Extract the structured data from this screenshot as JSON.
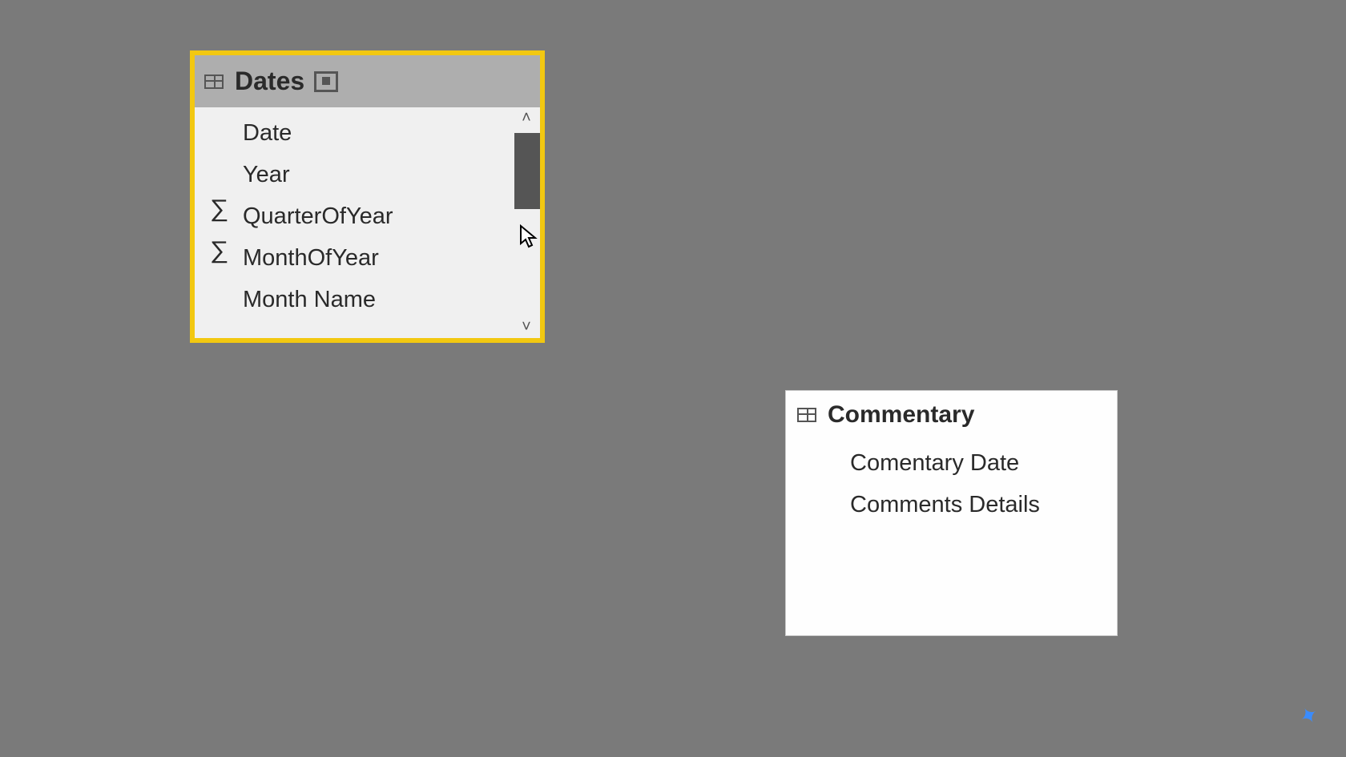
{
  "dates_table": {
    "title": "Dates",
    "fields": [
      {
        "label": "Date",
        "sigma": false
      },
      {
        "label": "Year",
        "sigma": false
      },
      {
        "label": "QuarterOfYear",
        "sigma": true
      },
      {
        "label": "MonthOfYear",
        "sigma": true
      },
      {
        "label": "Month Name",
        "sigma": false
      }
    ]
  },
  "commentary_table": {
    "title": "Commentary",
    "fields": [
      {
        "label": "Comentary Date"
      },
      {
        "label": "Comments Details"
      }
    ]
  }
}
